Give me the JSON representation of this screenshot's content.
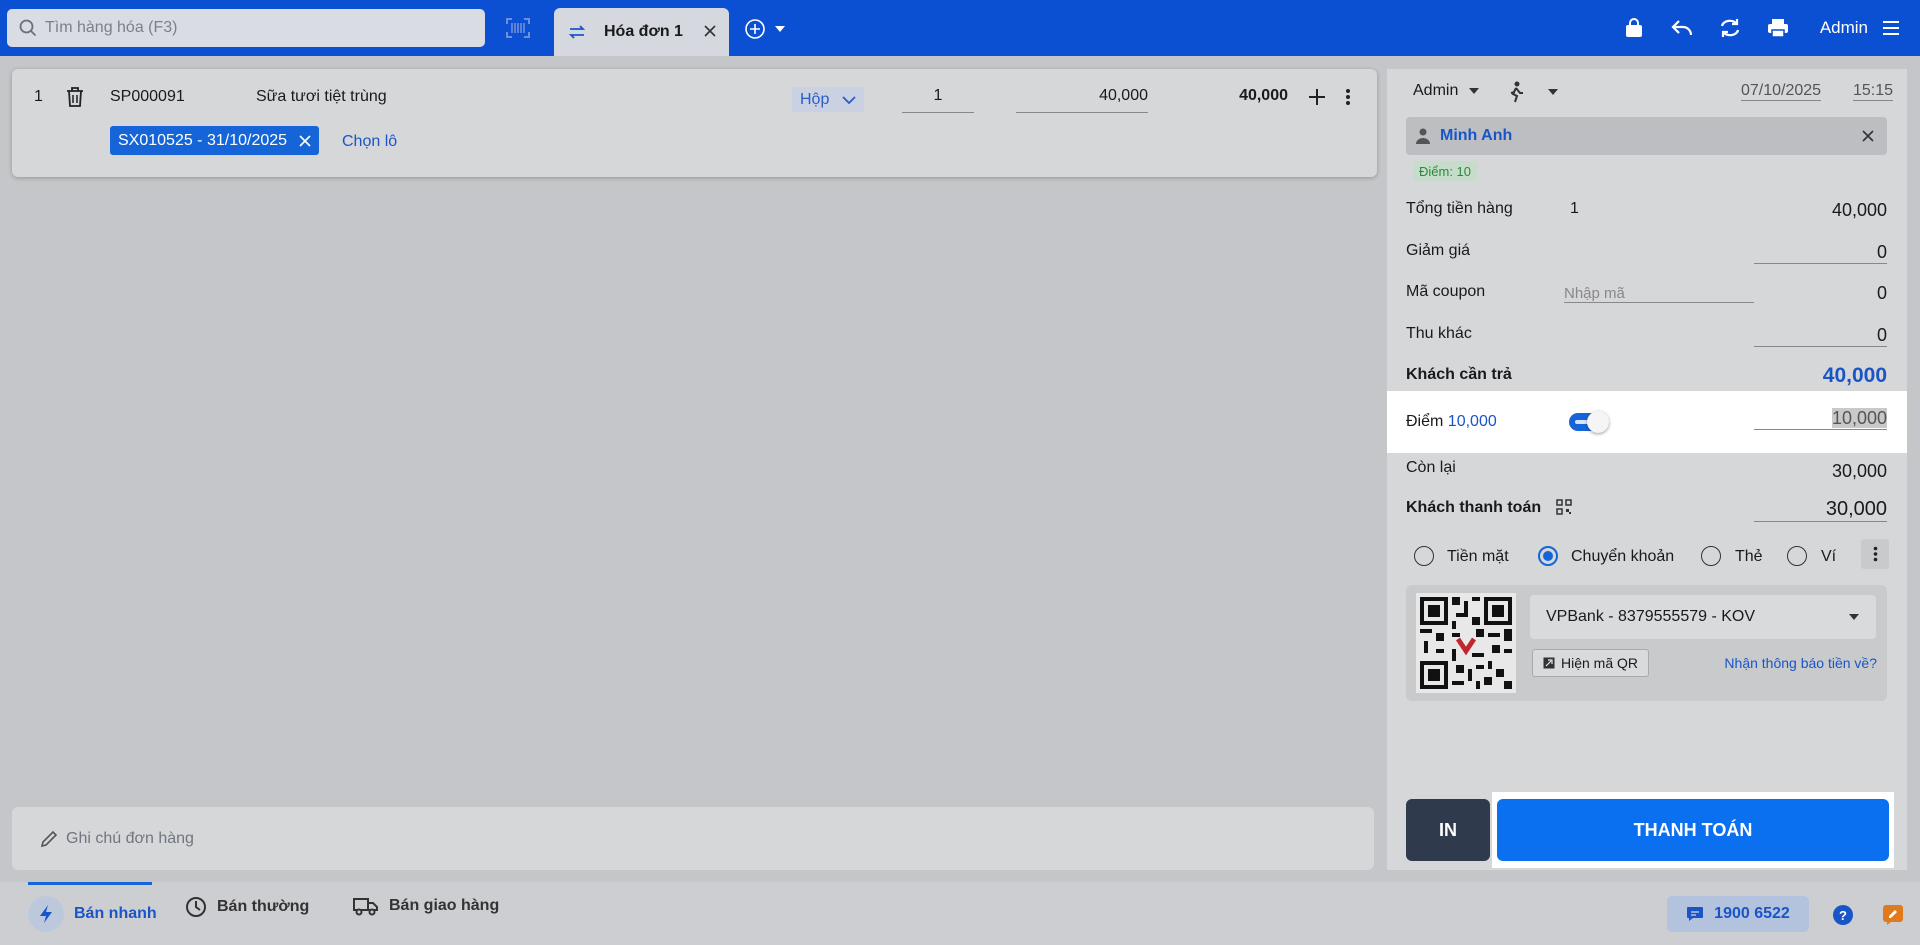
{
  "topbar": {
    "search_placeholder": "Tìm hàng hóa (F3)",
    "tab_label": "Hóa đơn 1",
    "user": "Admin"
  },
  "item": {
    "index": "1",
    "code": "SP000091",
    "name": "Sữa tươi tiệt trùng",
    "unit": "Hộp",
    "quantity": "1",
    "price": "40,000",
    "total": "40,000",
    "lot": "SX010525 - 31/10/2025",
    "choose_lot": "Chọn lô"
  },
  "note_placeholder": "Ghi chú đơn hàng",
  "panel": {
    "seller": "Admin",
    "date": "07/10/2025",
    "time": "15:15",
    "customer": "Minh Anh",
    "points_badge": "Điểm: 10",
    "total_goods_label": "Tổng tiền hàng",
    "total_goods_count": "1",
    "total_goods_value": "40,000",
    "discount_label": "Giảm giá",
    "discount_value": "0",
    "coupon_label": "Mã coupon",
    "coupon_placeholder": "Nhập mã",
    "coupon_value": "0",
    "other_fee_label": "Thu khác",
    "other_fee_value": "0",
    "to_pay_label": "Khách cần trả",
    "to_pay_value": "40,000",
    "points_label": "Điểm",
    "points_amount": "10,000",
    "points_value": "10,000",
    "remaining_label": "Còn lại",
    "remaining_value": "30,000",
    "customer_pay_label": "Khách thanh toán",
    "customer_pay_value": "30,000",
    "methods": [
      "Tiền mặt",
      "Chuyển khoản",
      "Thẻ",
      "Ví"
    ],
    "selected_method": "Chuyển khoản",
    "bank": "VPBank - 8379555579 - KOV",
    "show_qr": "Hiện mã QR",
    "notify": "Nhận thông báo tiền về?",
    "print_button": "IN",
    "pay_button": "THANH TOÁN"
  },
  "bottombar": {
    "quick_sale": "Bán nhanh",
    "normal_sale": "Bán thường",
    "delivery_sale": "Bán giao hàng",
    "hotline": "1900 6522"
  },
  "colors": {
    "brand_blue": "#0b4fd3",
    "primary_button": "#0b70f0",
    "dark_button": "#2f3a4c"
  }
}
